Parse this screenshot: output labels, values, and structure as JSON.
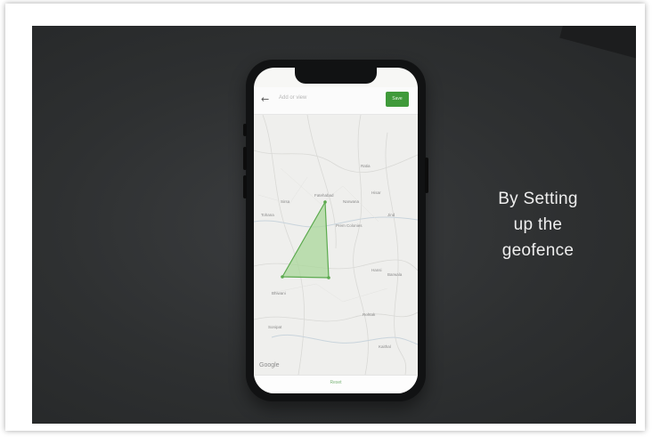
{
  "caption": {
    "line1": "By Setting",
    "line2": "up the",
    "line3": "geofence"
  },
  "app": {
    "back_icon": "arrow-left-icon",
    "back_glyph": "←",
    "search_placeholder": "Add or view",
    "save_label": "Save",
    "bottom_label": "Reset"
  },
  "map": {
    "attribution": "Google",
    "labels": [
      "Sirsa",
      "Fatehabad",
      "Hisar",
      "Ratia",
      "Tohana",
      "Narwana",
      "Jind",
      "Prem Colonies",
      "Hansi",
      "Barwala",
      "Bhiwani",
      "Rohtak",
      "Sonipat",
      "Kaithal"
    ]
  },
  "colors": {
    "accent_green": "#3f9a3a",
    "geofence_fill": "#a9d79a",
    "geofence_stroke": "#5caa4f",
    "background": "#2e3031"
  }
}
